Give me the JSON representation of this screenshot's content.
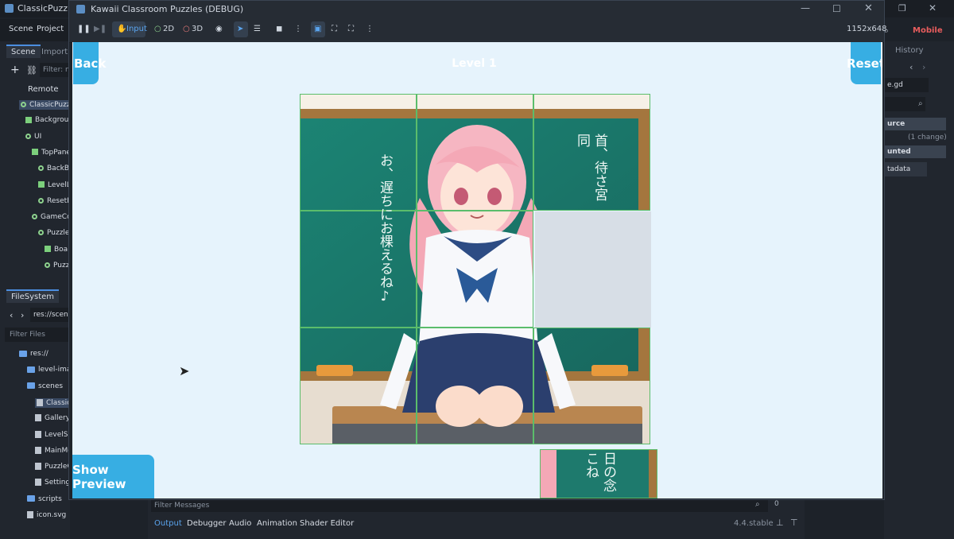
{
  "editor": {
    "window_title": "ClassicPuzzleG",
    "menu": [
      "Scene",
      "Project"
    ],
    "scene_tabs": [
      "Scene",
      "Import"
    ],
    "scene_filter_placeholder": "Filter: n",
    "remote_label": "Remote",
    "scene_tree": [
      {
        "label": "ClassicPuzzl",
        "kind": "dot",
        "indent": 0
      },
      {
        "label": "Backgrour",
        "kind": "sq",
        "indent": 1
      },
      {
        "label": "UI",
        "kind": "dot",
        "indent": 1
      },
      {
        "label": "TopPane",
        "kind": "grid",
        "indent": 2
      },
      {
        "label": "BackBu",
        "kind": "person",
        "indent": 3
      },
      {
        "label": "LevelL",
        "kind": "label",
        "indent": 3
      },
      {
        "label": "ResetE",
        "kind": "person",
        "indent": 3
      },
      {
        "label": "GameCo",
        "kind": "dot",
        "indent": 2
      },
      {
        "label": "Puzzle",
        "kind": "dot",
        "indent": 3
      },
      {
        "label": "Boar",
        "kind": "sq",
        "indent": 4
      },
      {
        "label": "Puzzle",
        "kind": "dot",
        "indent": 4
      }
    ],
    "filesystem_tab": "FileSystem",
    "path": "res://scene",
    "filter_files": "Filter Files",
    "files": [
      {
        "label": "res://",
        "kind": "folder",
        "indent": 0
      },
      {
        "label": "level-imag",
        "kind": "folder",
        "indent": 1
      },
      {
        "label": "scenes",
        "kind": "folder",
        "indent": 1
      },
      {
        "label": "ClassicPu",
        "kind": "file",
        "indent": 2
      },
      {
        "label": "Gallery.t",
        "kind": "file",
        "indent": 2
      },
      {
        "label": "LevelSel",
        "kind": "file",
        "indent": 2
      },
      {
        "label": "MainMe",
        "kind": "file",
        "indent": 2
      },
      {
        "label": "PuzzleG",
        "kind": "file",
        "indent": 2
      },
      {
        "label": "Settings",
        "kind": "file",
        "indent": 2
      },
      {
        "label": "scripts",
        "kind": "folder",
        "indent": 1
      },
      {
        "label": "icon.svg",
        "kind": "file",
        "indent": 1
      }
    ],
    "right": {
      "renderer": "Mobile",
      "history": "History",
      "script_file": "e.gd",
      "source": "urce",
      "changes": "(1 change)",
      "unted": "unted",
      "metadata": "tadata"
    },
    "bottom": {
      "filter_messages": "Filter Messages",
      "count": "0",
      "tabs": [
        "Output",
        "Debugger",
        "Audio",
        "Animation",
        "Shader Editor"
      ],
      "version": "4.4.stable"
    }
  },
  "game_window": {
    "title": "Kawaii Classroom Puzzles (DEBUG)",
    "toolbar": {
      "input": "Input",
      "two_d": "2D",
      "three_d": "3D",
      "resolution": "1152x648"
    },
    "level_title": "Level 1",
    "back_button": "Back",
    "reset_button": "Reset",
    "show_preview_button": "Show Preview",
    "chalk_left": "お、遅ちにお棵えるね♪",
    "chalk_right": "首、待さ宮同",
    "loose_tile_chalk": "日の念こね"
  },
  "colors": {
    "accent": "#37aee3",
    "tile_border": "#5bbd6b",
    "viewport_bg": "#e6f3fc",
    "board_green": "#1e7a6d"
  }
}
